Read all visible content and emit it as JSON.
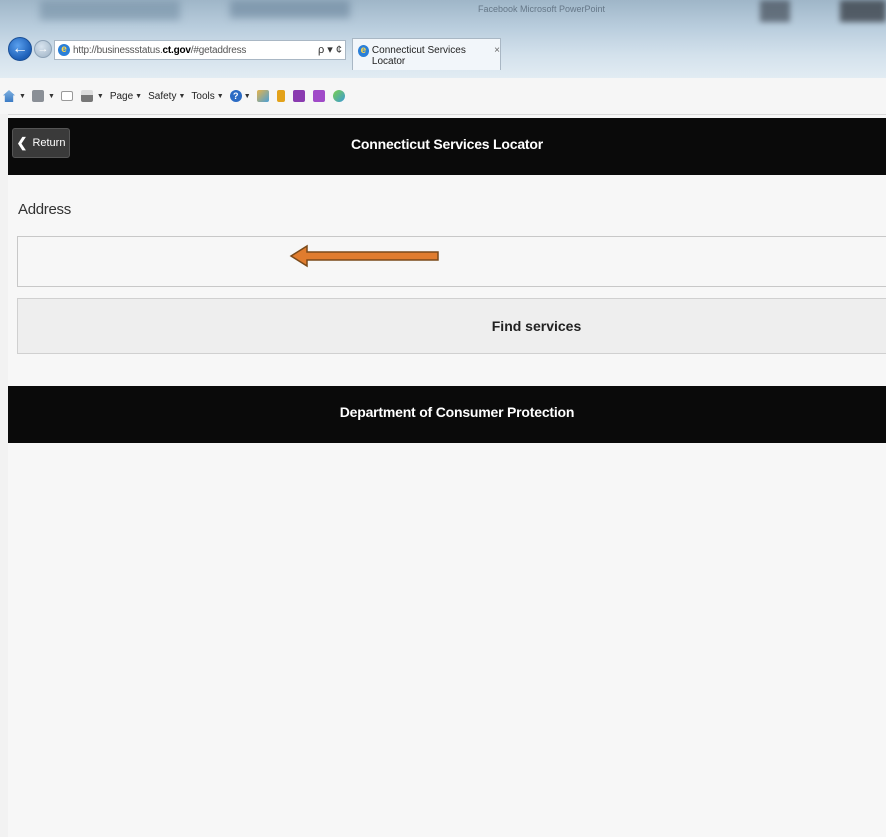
{
  "browser": {
    "window_title": "Facebook  Microsoft PowerPoint",
    "url_prefix": "http://businessstatus.",
    "url_domain": "ct.gov",
    "url_suffix": "/#getaddress",
    "tab_title": "Connecticut Services Locator",
    "tab_close": "×",
    "addr_actions": "ρ ▾ ¢",
    "back_glyph": "←",
    "forward_glyph": "→"
  },
  "command_bar": {
    "page": "Page",
    "safety": "Safety",
    "tools": "Tools",
    "help_glyph": "?",
    "caret": "▼"
  },
  "header": {
    "return_label": "Return",
    "return_glyph": "❮",
    "title": "Connecticut Services Locator"
  },
  "form": {
    "address_label": "Address",
    "address_value": "",
    "find_button": "Find services"
  },
  "footer": {
    "text": "Department of Consumer Protection"
  },
  "colors": {
    "header_bg": "#0a0a0a",
    "arrow": "#e07c2e",
    "ie_blue": "#2a7fd8"
  },
  "icons": [
    "back-arrow-icon",
    "forward-arrow-icon",
    "ie-logo-icon",
    "search-icon",
    "refresh-icon",
    "close-icon",
    "home-icon",
    "rss-feed-icon",
    "mail-icon",
    "print-icon",
    "help-icon",
    "chevron-left-icon",
    "orange-arrow-annotation"
  ]
}
